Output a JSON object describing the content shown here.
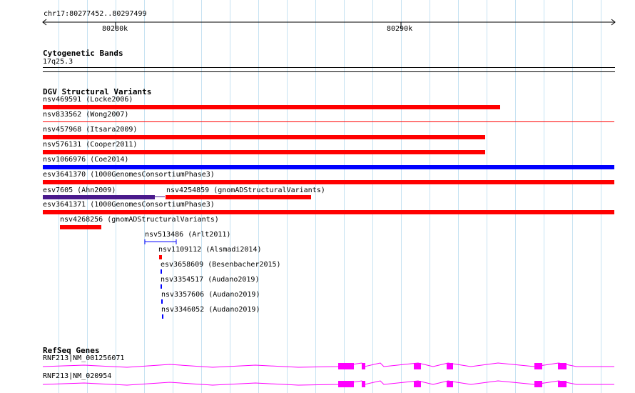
{
  "ruler": {
    "region": "chr17:80277452..80297499",
    "ticks": [
      "80280k",
      "80290k"
    ]
  },
  "tracks": {
    "cytobands": {
      "title": "Cytogenetic Bands",
      "band": "17q25.3"
    },
    "dgv": {
      "title": "DGV Structural Variants",
      "variants": [
        {
          "label": "nsv469591 (Locke2006)",
          "color": "#ff0000"
        },
        {
          "label": "nsv833562 (Wong2007)",
          "color": "#ff0000"
        },
        {
          "label": "nsv457968 (Itsara2009)",
          "color": "#ff0000"
        },
        {
          "label": "nsv576131 (Cooper2011)",
          "color": "#ff0000"
        },
        {
          "label": "nsv1066976 (Coe2014)",
          "color": "#0000ff"
        },
        {
          "label": "esv3641370 (1000GenomesConsortiumPhase3)",
          "color": "#ff0000"
        },
        {
          "label": "esv7605 (Ahn2009)",
          "color": "#4a1a8c"
        },
        {
          "label": "nsv4254859 (gnomADStructuralVariants)",
          "color": "#ff0000"
        },
        {
          "label": "esv3641371 (1000GenomesConsortiumPhase3)",
          "color": "#ff0000"
        },
        {
          "label": "nsv4268256 (gnomADStructuralVariants)",
          "color": "#ff0000"
        },
        {
          "label": "nsv513486 (Arlt2011)",
          "color": "#0000ff"
        },
        {
          "label": "nsv1109112 (Alsmadi2014)",
          "color": "#ff0000"
        },
        {
          "label": "esv3658609 (Besenbacher2015)",
          "color": "#0000ff"
        },
        {
          "label": "nsv3354517 (Audano2019)",
          "color": "#0000ff"
        },
        {
          "label": "nsv3357606 (Audano2019)",
          "color": "#0000ff"
        },
        {
          "label": "nsv3346052 (Audano2019)",
          "color": "#0000ff"
        }
      ]
    },
    "refseq": {
      "title": "RefSeq Genes",
      "color": "#ff00ff",
      "genes": [
        {
          "label": "RNF213|NM_001256071"
        },
        {
          "label": "RNF213|NM_020954"
        }
      ]
    }
  },
  "colors": {
    "gridline": "#c6e2f2",
    "deletion": "#ff0000",
    "duplication": "#0000ff",
    "gene": "#ff00ff"
  }
}
